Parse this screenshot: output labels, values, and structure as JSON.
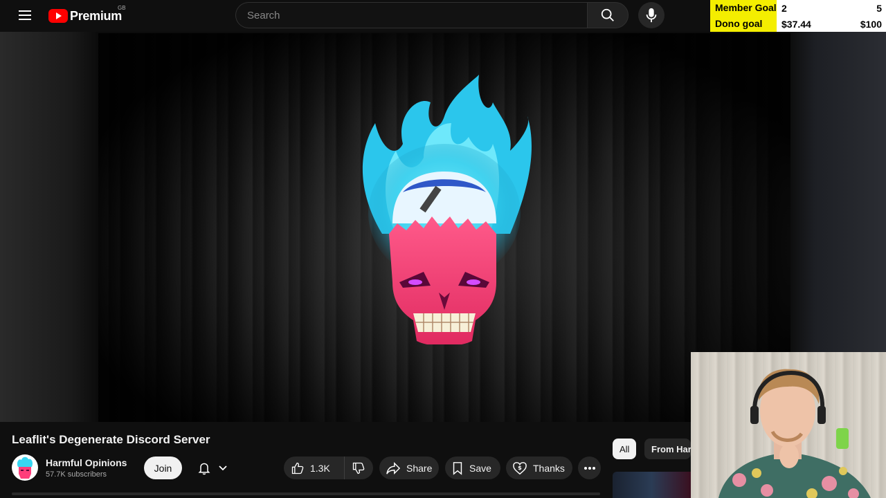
{
  "header": {
    "brand": "Premium",
    "region": "GB",
    "search_placeholder": "Search"
  },
  "overlay": {
    "goals": [
      {
        "label": "Member Goal",
        "current": "2",
        "target": "5"
      },
      {
        "label": "Dono goal",
        "current": "$37.44",
        "target": "$100"
      }
    ]
  },
  "video": {
    "title": "Leaflit's Degenerate Discord Server"
  },
  "channel": {
    "name": "Harmful Opinions",
    "subscribers": "57.7K subscribers",
    "join_label": "Join"
  },
  "actions": {
    "likes": "1.3K",
    "share_label": "Share",
    "save_label": "Save",
    "thanks_label": "Thanks"
  },
  "chips": {
    "all": "All",
    "from": "From Har"
  },
  "colors": {
    "brand_red": "#ff0000",
    "goal_yellow": "#f4ee00",
    "skull_pink": "#ff3d7a",
    "flame_cyan": "#38d6f2"
  }
}
